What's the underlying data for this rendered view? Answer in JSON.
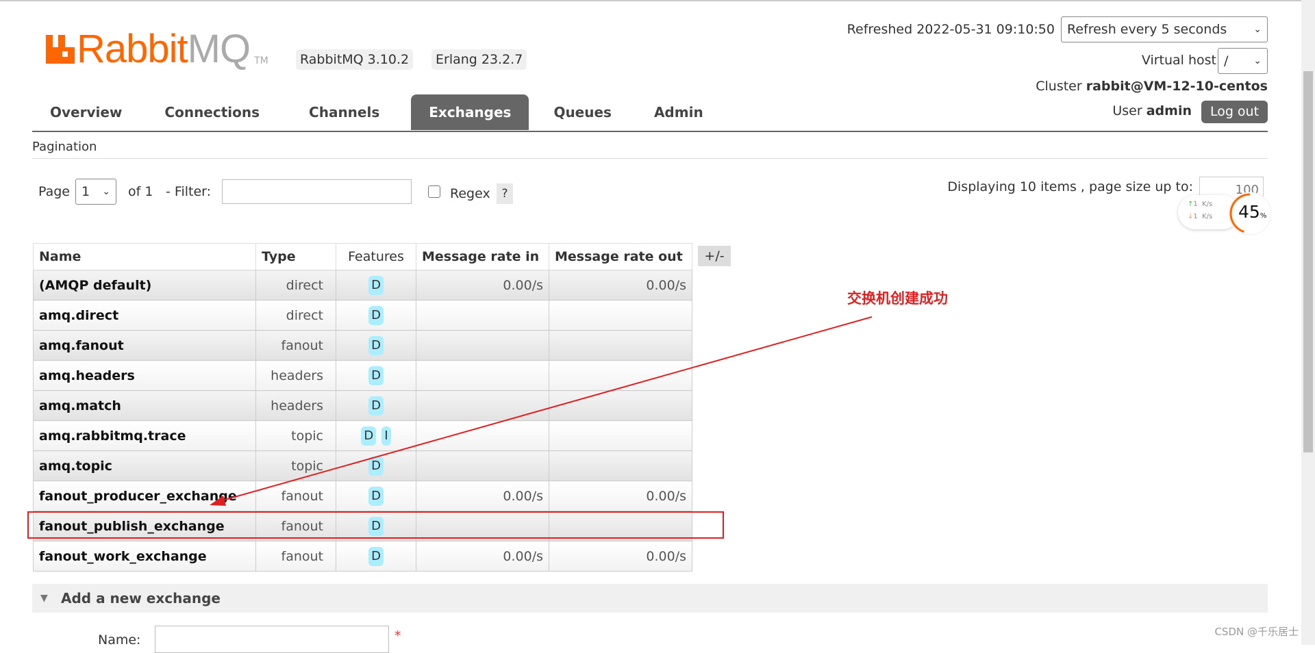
{
  "app": {
    "logo_text_a": "Rabbit",
    "logo_text_b": "MQ",
    "tm": "TM",
    "version": "RabbitMQ 3.10.2",
    "erlang": "Erlang 23.2.7"
  },
  "header": {
    "refreshed": "Refreshed 2022-05-31 09:10:50",
    "refresh_select": "Refresh every 5 seconds",
    "vhost_label": "Virtual host",
    "vhost_value": "/",
    "cluster_label": "Cluster",
    "cluster_value": "rabbit@VM-12-10-centos",
    "user_label": "User",
    "user_value": "admin",
    "logout": "Log out"
  },
  "tabs": [
    {
      "label": "Overview"
    },
    {
      "label": "Connections"
    },
    {
      "label": "Channels"
    },
    {
      "label": "Exchanges",
      "active": true
    },
    {
      "label": "Queues"
    },
    {
      "label": "Admin"
    }
  ],
  "pagination": {
    "title": "Pagination",
    "page_label": "Page",
    "page_value": "1",
    "of": "of 1",
    "filter_label": "- Filter:",
    "filter_value": "",
    "regex_label": "Regex",
    "help": "?",
    "displaying": "Displaying 10 items , page size up to:",
    "page_size": "100"
  },
  "table": {
    "columns": [
      "Name",
      "Type",
      "Features",
      "Message rate in",
      "Message rate out"
    ],
    "toggle": "+/-",
    "rows": [
      {
        "name": "(AMQP default)",
        "type": "direct",
        "features": [
          "D"
        ],
        "in": "0.00/s",
        "out": "0.00/s"
      },
      {
        "name": "amq.direct",
        "type": "direct",
        "features": [
          "D"
        ],
        "in": "",
        "out": ""
      },
      {
        "name": "amq.fanout",
        "type": "fanout",
        "features": [
          "D"
        ],
        "in": "",
        "out": ""
      },
      {
        "name": "amq.headers",
        "type": "headers",
        "features": [
          "D"
        ],
        "in": "",
        "out": ""
      },
      {
        "name": "amq.match",
        "type": "headers",
        "features": [
          "D"
        ],
        "in": "",
        "out": ""
      },
      {
        "name": "amq.rabbitmq.trace",
        "type": "topic",
        "features": [
          "D",
          "I"
        ],
        "in": "",
        "out": ""
      },
      {
        "name": "amq.topic",
        "type": "topic",
        "features": [
          "D"
        ],
        "in": "",
        "out": ""
      },
      {
        "name": "fanout_producer_exchange",
        "type": "fanout",
        "features": [
          "D"
        ],
        "in": "0.00/s",
        "out": "0.00/s"
      },
      {
        "name": "fanout_publish_exchange",
        "type": "fanout",
        "features": [
          "D"
        ],
        "in": "",
        "out": ""
      },
      {
        "name": "fanout_work_exchange",
        "type": "fanout",
        "features": [
          "D"
        ],
        "in": "0.00/s",
        "out": "0.00/s"
      }
    ]
  },
  "annotation": "交换机创建成功",
  "add_section": {
    "title": "Add a new exchange",
    "name_label": "Name:",
    "required": "*"
  },
  "widget": {
    "up": "1",
    "down": "1",
    "unit": "K/s",
    "percent": "45",
    "percent_sign": "%",
    "percent_value": 45
  },
  "watermark": "CSDN @千乐居士",
  "colors": {
    "brand": "#f60",
    "active_tab": "#666",
    "annotation": "#e02020",
    "feature_badge": "#aaeeff"
  }
}
